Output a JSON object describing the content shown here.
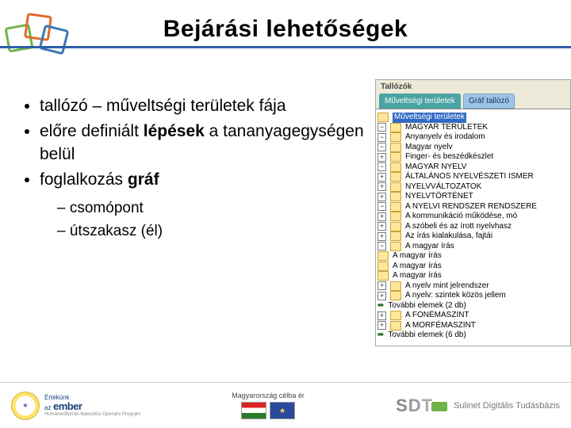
{
  "title": "Bejárási lehetőségek",
  "bullets": {
    "b1a": "tallózó – műveltségi területek fája",
    "b2a": "előre definiált ",
    "b2b": "lépések",
    "b2c": " a tananyagegységen belül",
    "b3a": "foglalkozás ",
    "b3b": "gráf",
    "sub1": "csomópont",
    "sub2": "útszakasz (él)"
  },
  "browser": {
    "title": "Tallózók",
    "tab1": "Műveltségi területek",
    "tab2": "Gráf tallózó",
    "tree": {
      "n0": "Műveltségi területek",
      "n1": "MAGYAR TERÜLETEK",
      "n2": "Anyanyelv és irodalom",
      "n3": "Magyar nyelv",
      "n4": "Finger- és beszédkészlet",
      "n5": "MAGYAR NYELV",
      "n6": "ÁLTALÁNOS NYELVÉSZETI ISMER",
      "n7": "NYELVVÁLTOZATOK",
      "n8": "NYELVTÖRTÉNET",
      "n9": "A NYELVI RENDSZER RENDSZERE",
      "n10": "A kommunikáció működése, mó",
      "n11": "A szóbeli és az írott nyelvhasz",
      "n12": "Az írás kialakulása, fajtái",
      "n13": "A magyar írás",
      "n14": "A magyar írás",
      "n15": "A magyar írás",
      "n16": "A magyar írás",
      "n17": "A nyelv mint jelrendszer",
      "n18": "A nyelv: szintek közös jellem",
      "n19": "További elemek (2 db)",
      "n20": "A FONÉMASZINT",
      "n21": "A MORFÉMASZINT",
      "n22": "További elemek (6 db)"
    }
  },
  "footer": {
    "ember_top": "Értékünk",
    "ember_mid": "az",
    "ember_big": "ember",
    "ember_sub": "Humánerőforrás-fejlesztési Operatív Program",
    "mid": "Magyarország célba ér",
    "sdt": "Sulinet Digitális Tudásbázis"
  }
}
